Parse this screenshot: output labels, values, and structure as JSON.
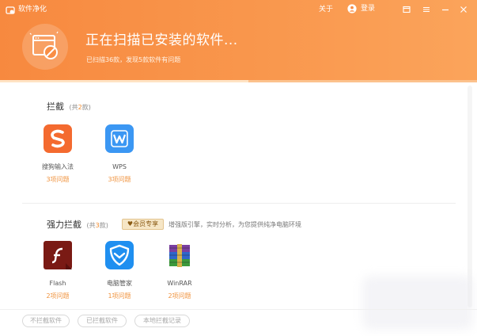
{
  "window": {
    "title": "软件净化",
    "about": "关于",
    "login": "登录"
  },
  "scan": {
    "title": "正在扫描已安装的软件...",
    "subtitle": "已扫描36款，发现5款软件有问题",
    "progress": 0.52
  },
  "sections": [
    {
      "title": "拦截",
      "count_prefix": "(共",
      "count": "2",
      "count_suffix": "款)",
      "apps": [
        {
          "name": "搜狗输入法",
          "issues": "3项问题",
          "icon": "sogou-icon",
          "color": "#f46a2f"
        },
        {
          "name": "WPS",
          "issues": "3项问题",
          "icon": "wps-icon",
          "color": "#3b97f3"
        }
      ]
    },
    {
      "title": "强力拦截",
      "count_prefix": "(共",
      "count": "3",
      "count_suffix": "款)",
      "vip_badge": "♥会员专享",
      "vip_desc": "增强版引擎，实时分析，为您提供纯净电脑环境",
      "apps": [
        {
          "name": "Flash",
          "issues": "2项问题",
          "icon": "flash-icon",
          "color": "#7a1a14"
        },
        {
          "name": "电脑管家",
          "issues": "1项问题",
          "icon": "pc-manager-icon",
          "color": "#1f8ff0"
        },
        {
          "name": "WinRAR",
          "issues": "2项问题",
          "icon": "winrar-icon",
          "color": "#6a4c9c"
        }
      ]
    }
  ],
  "footer": {
    "buttons": [
      "不拦截软件",
      "已拦截软件",
      "本地拦截记录"
    ]
  },
  "colors": {
    "header": "#f98e45",
    "accent": "#f0933e"
  }
}
